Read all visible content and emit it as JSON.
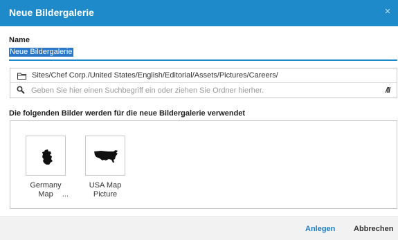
{
  "dialog": {
    "title": "Neue Bildergalerie",
    "close_glyph": "×"
  },
  "name_field": {
    "label": "Name",
    "value": "Neue Bildergalerie"
  },
  "folder": {
    "path": "Sites/Chef Corp./United States/English/Editorial/Assets/Pictures/Careers/",
    "icon": "folder-icon"
  },
  "search": {
    "placeholder": "Geben Sie hier einen Suchbegriff ein oder ziehen Sie Ordner hierher.",
    "icon": "search-icon",
    "tag_glyph": "/ll"
  },
  "gallery": {
    "label": "Die folgenden Bilder werden für die neue Bildergalerie verwendet",
    "items": [
      {
        "line1": "Germany",
        "line2": "Map",
        "ellipsis": "...",
        "icon": "germany-map-icon"
      },
      {
        "line1": "USA Map",
        "line2": "Picture",
        "icon": "usa-map-icon"
      }
    ]
  },
  "footer": {
    "create_label": "Anlegen",
    "cancel_label": "Abbrechen"
  },
  "colors": {
    "accent": "#1f8ac9",
    "selection": "#2a77c9",
    "link": "#1f7bc1"
  }
}
